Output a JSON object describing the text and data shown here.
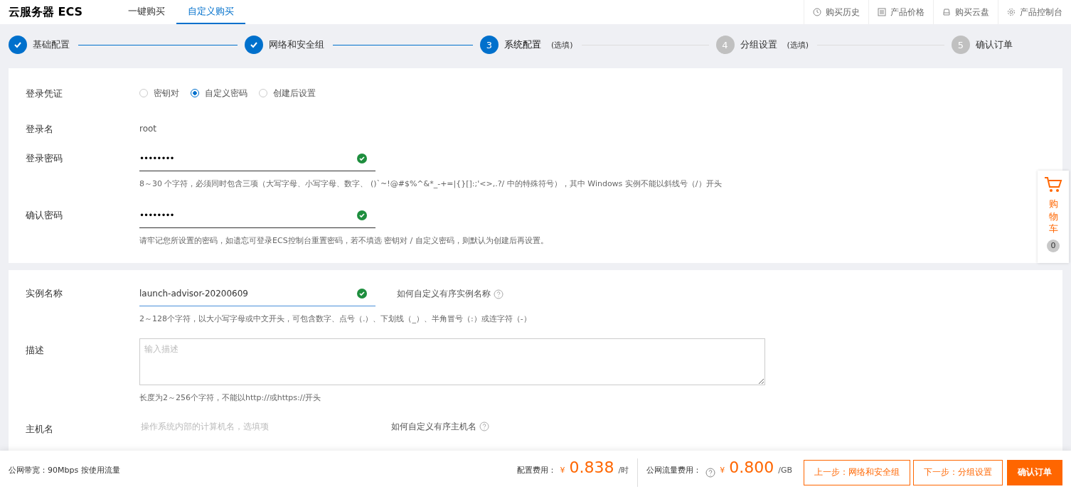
{
  "header": {
    "title": "云服务器 ECS",
    "tabs": [
      {
        "label": "一键购买",
        "selected": false
      },
      {
        "label": "自定义购买",
        "selected": true
      }
    ],
    "links": [
      {
        "kind": "clock",
        "label": "购买历史"
      },
      {
        "kind": "list",
        "label": "产品价格"
      },
      {
        "kind": "disk",
        "label": "购买云盘"
      },
      {
        "kind": "gear",
        "label": "产品控制台"
      }
    ]
  },
  "steps": [
    {
      "label": "基础配置",
      "done": true,
      "selected": false
    },
    {
      "label": "网络和安全组",
      "done": true,
      "selected": false
    },
    {
      "number": "3",
      "label": "系统配置",
      "note": "(选填)",
      "done": false,
      "selected": true
    },
    {
      "number": "4",
      "label": "分组设置",
      "note": "(选填)",
      "done": false,
      "selected": false
    },
    {
      "number": "5",
      "label": "确认订单",
      "done": false,
      "selected": false
    }
  ],
  "login": {
    "credential_label": "登录凭证",
    "options": [
      {
        "label": "密钥对",
        "selected": false
      },
      {
        "label": "自定义密码",
        "selected": true
      },
      {
        "label": "创建后设置",
        "selected": false
      }
    ],
    "username_label": "登录名",
    "username": "root",
    "password_label": "登录密码",
    "password": "••••••••",
    "password_valid": true,
    "password_hint": "8～30 个字符，必须同时包含三项（大写字母、小写字母、数字、 ()`~!@#$%^&*_-+=|{}[]:;'<>,.?/ 中的特殊符号），其中 Windows 实例不能以斜线号（/）开头",
    "confirm_label": "确认密码",
    "confirm": "••••••••",
    "confirm_valid": true,
    "confirm_hint": "请牢记您所设置的密码，如遗忘可登录ECS控制台重置密码，若不填选 密钥对 / 自定义密码，则默认为创建后再设置。"
  },
  "instance": {
    "name_label": "实例名称",
    "name": "launch-advisor-20200609",
    "name_valid": true,
    "name_help": "如何自定义有序实例名称",
    "name_hint": "2～128个字符，以大小写字母或中文开头，可包含数字、点号（.）、下划线（_）、半角冒号（:）或连字符（-）",
    "desc_label": "描述",
    "desc_placeholder": "输入描述",
    "desc_hint": "长度为2～256个字符，不能以http://或https://开头",
    "host_label": "主机名",
    "host_placeholder": "操作系统内部的计算机名，选填项",
    "host_help": "如何自定义有序主机名"
  },
  "cart": {
    "label": "购物车",
    "count": "0"
  },
  "footer": {
    "bandwidth": "公网带宽：90Mbps 按使用流量",
    "config_label": "配置费用：",
    "config_currency": "¥",
    "config_price": "0.838",
    "config_unit": "/时",
    "traffic_label": "公网流量费用：",
    "traffic_currency": "¥",
    "traffic_price": "0.800",
    "traffic_unit": "/GB",
    "buttons": [
      {
        "kind": "outline",
        "label": "上一步：网络和安全组"
      },
      {
        "kind": "outline",
        "label": "下一步：分组设置"
      },
      {
        "kind": "primary",
        "label": "确认订单"
      }
    ]
  }
}
